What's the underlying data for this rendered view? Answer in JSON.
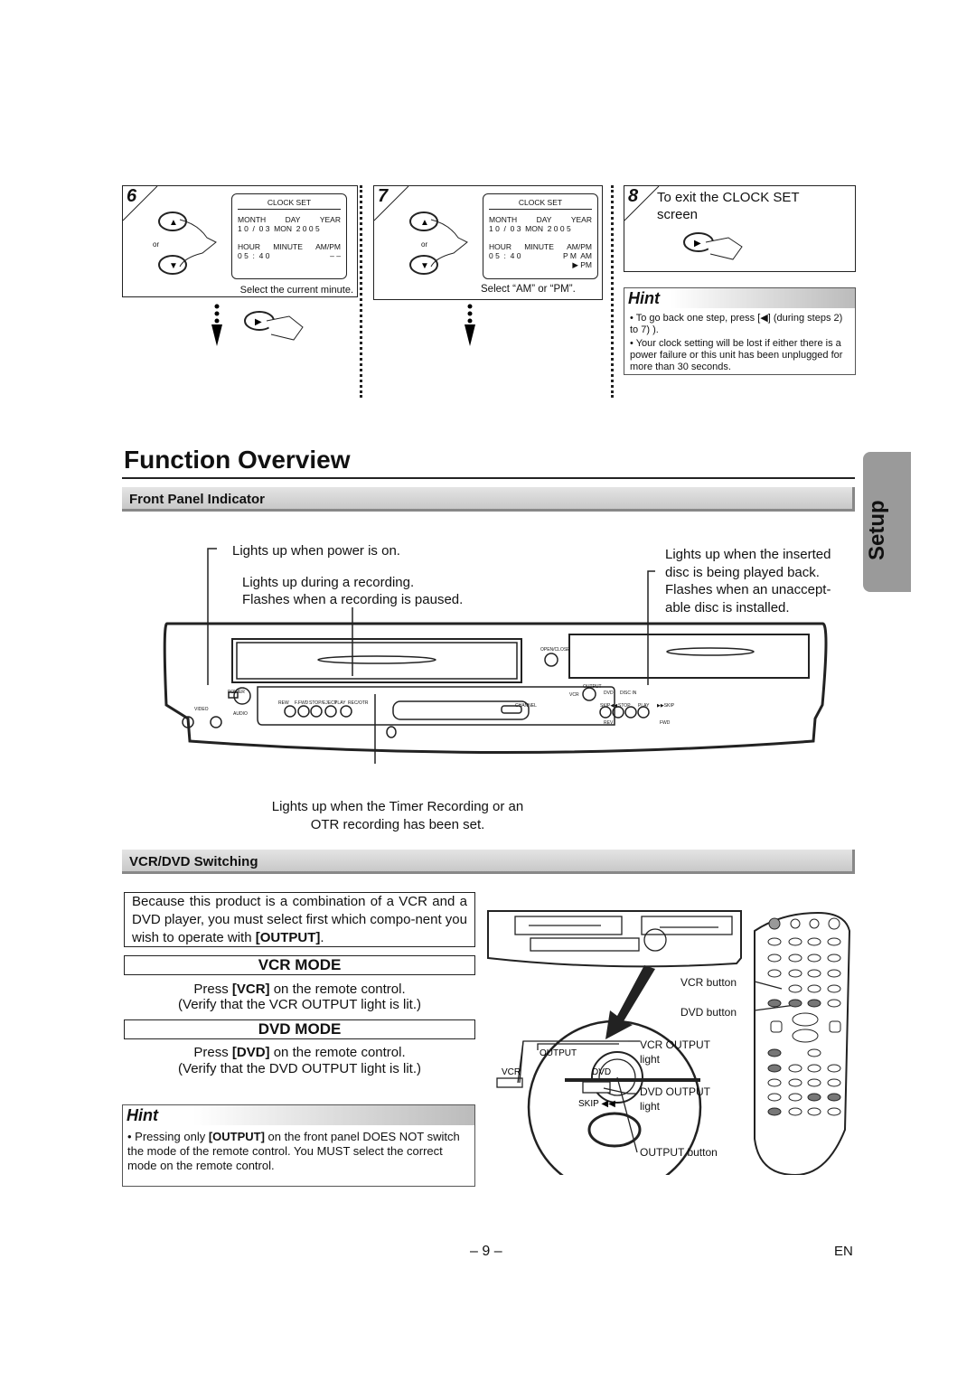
{
  "steps": {
    "s6": {
      "num": "6",
      "clock_title": "CLOCK SET",
      "month": "MONTH",
      "day": "DAY",
      "year": "YEAR",
      "date": "1 0  /  0 3  MON  2 0 0 5",
      "hour": "HOUR",
      "minute": "MINUTE",
      "ampm": "AM/PM",
      "time": "0 5  :  4 0",
      "ampm_val": "– –",
      "or": "or",
      "caption": "Select the current minute."
    },
    "s7": {
      "num": "7",
      "clock_title": "CLOCK SET",
      "month": "MONTH",
      "day": "DAY",
      "year": "YEAR",
      "date": "1 0  /  0 3  MON  2 0 0 5",
      "hour": "HOUR",
      "minute": "MINUTE",
      "ampm": "AM/PM",
      "time": "0 5  :  4 0",
      "ampm_val": "P M  AM",
      "ampm_sel": "▶ PM",
      "or": "or",
      "caption": "Select “AM” or “PM”."
    },
    "s8": {
      "num": "8",
      "text": "To exit the CLOCK SET screen"
    }
  },
  "hint_top": {
    "title": "Hint",
    "items": [
      "• To go back one step, press [◀] (during steps 2) to 7) ).",
      "• Your clock setting will be lost if either there is a power failure or this unit has been unplugged for more than 30 seconds."
    ]
  },
  "title": "Function Overview",
  "side_tab": "Setup",
  "front_panel": {
    "heading": "Front Panel Indicator",
    "power_note": "Lights up when power is on.",
    "rec_note": "Lights up during a recording.\nFlashes when a recording is paused.",
    "disc_note": "Lights up when the inserted disc is being played back. Flashes when an unaccept-able disc is installed.",
    "timer_note": "Lights up when the Timer Recording or an OTR recording has been set.",
    "labels": {
      "open_close": "OPEN/CLOSE",
      "power": "POWER",
      "video": "VIDEO",
      "audio": "AUDIO",
      "rew": "REW",
      "ffwd": "F.FWD",
      "stop_eject": "STOP/EJECT",
      "play": "PLAY",
      "rec_otr": "REC/OTR",
      "channel": "CHANNEL",
      "output": "OUTPUT",
      "vcr": "VCR",
      "dvd": "DVD",
      "disc_in": "DISC IN",
      "skip_back": "SKIP◀◀",
      "stop": "STOP",
      "play2": "PLAY",
      "skip_fwd": "▶▶SKIP",
      "rev": "REV",
      "fwd": "FWD"
    }
  },
  "switching": {
    "heading": "VCR/DVD Switching",
    "intro_pre": "Because this product is a combination of a VCR and a DVD player, you must select first which compo-nent you wish to operate with ",
    "intro_key": "[OUTPUT]",
    "intro_post": ".",
    "vcr_mode": {
      "title": "VCR MODE",
      "line1_pre": "Press ",
      "line1_key": "[VCR]",
      "line1_post": " on the remote control.",
      "line2": "(Verify that the VCR OUTPUT light is lit.)"
    },
    "dvd_mode": {
      "title": "DVD MODE",
      "line1_pre": "Press ",
      "line1_key": "[DVD]",
      "line1_post": " on the remote control.",
      "line2": "(Verify that the DVD OUTPUT light is lit.)"
    },
    "hint": {
      "title": "Hint",
      "pre": "• Pressing only ",
      "key": "[OUTPUT]",
      "post": " on the front panel DOES NOT switch the mode of the remote control. You MUST select the correct mode on the remote control."
    },
    "callouts": {
      "vcr_button": "VCR button",
      "dvd_button": "DVD button",
      "vcr_output": "VCR OUTPUT\nlight",
      "dvd_output": "DVD OUTPUT\nlight",
      "output_button": "OUTPUT button"
    },
    "detail": {
      "output": "OUTPUT",
      "vcr": "VCR",
      "dvd": "DVD",
      "skip": "SKIP ◀◀"
    }
  },
  "footer": {
    "page": "– 9 –",
    "lang": "EN"
  }
}
